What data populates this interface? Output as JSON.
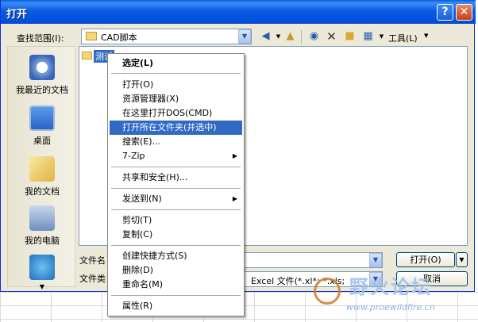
{
  "window": {
    "title": "打开",
    "help_glyph": "?",
    "close_glyph": "✕"
  },
  "toolbar": {
    "look_in_label": "查找范围(I):",
    "look_in_value": "CAD脚本",
    "tools_label": "工具(L)"
  },
  "places": [
    {
      "label": "我最近的文档",
      "icon": "recent-documents-icon"
    },
    {
      "label": "桌面",
      "icon": "desktop-icon"
    },
    {
      "label": "我的文档",
      "icon": "my-documents-icon"
    },
    {
      "label": "我的电脑",
      "icon": "my-computer-icon"
    },
    {
      "label": "",
      "icon": "network-places-icon"
    }
  ],
  "file_list": {
    "selected_item": "测试"
  },
  "bottom": {
    "file_name_label": "文件名",
    "file_name_value": "",
    "file_type_label": "文件类",
    "file_type_value": "Excel 文件(*.xl*; *.xls;",
    "open_button": "打开(O)",
    "cancel_button": "取消"
  },
  "context_menu": {
    "items": [
      {
        "label": "选定(L)"
      },
      {
        "label": "打开(O)"
      },
      {
        "label": "资源管理器(X)"
      },
      {
        "label": "在这里打开DOS(CMD)"
      },
      {
        "label": "打开所在文件夹(并选中)"
      },
      {
        "label": "搜索(E)..."
      },
      {
        "label": "7-Zip"
      },
      {
        "label": "共享和安全(H)..."
      },
      {
        "label": "发送到(N)"
      },
      {
        "label": "剪切(T)"
      },
      {
        "label": "复制(C)"
      },
      {
        "label": "创建快捷方式(S)"
      },
      {
        "label": "删除(D)"
      },
      {
        "label": "重命名(M)"
      },
      {
        "label": "属性(R)"
      }
    ]
  },
  "watermark": {
    "text": "野火论坛",
    "url": "www.proewildfire.cn"
  },
  "colors": {
    "title_bar": "#0a5be0",
    "highlight": "#316ac5",
    "dialog_bg": "#ece9d8"
  }
}
